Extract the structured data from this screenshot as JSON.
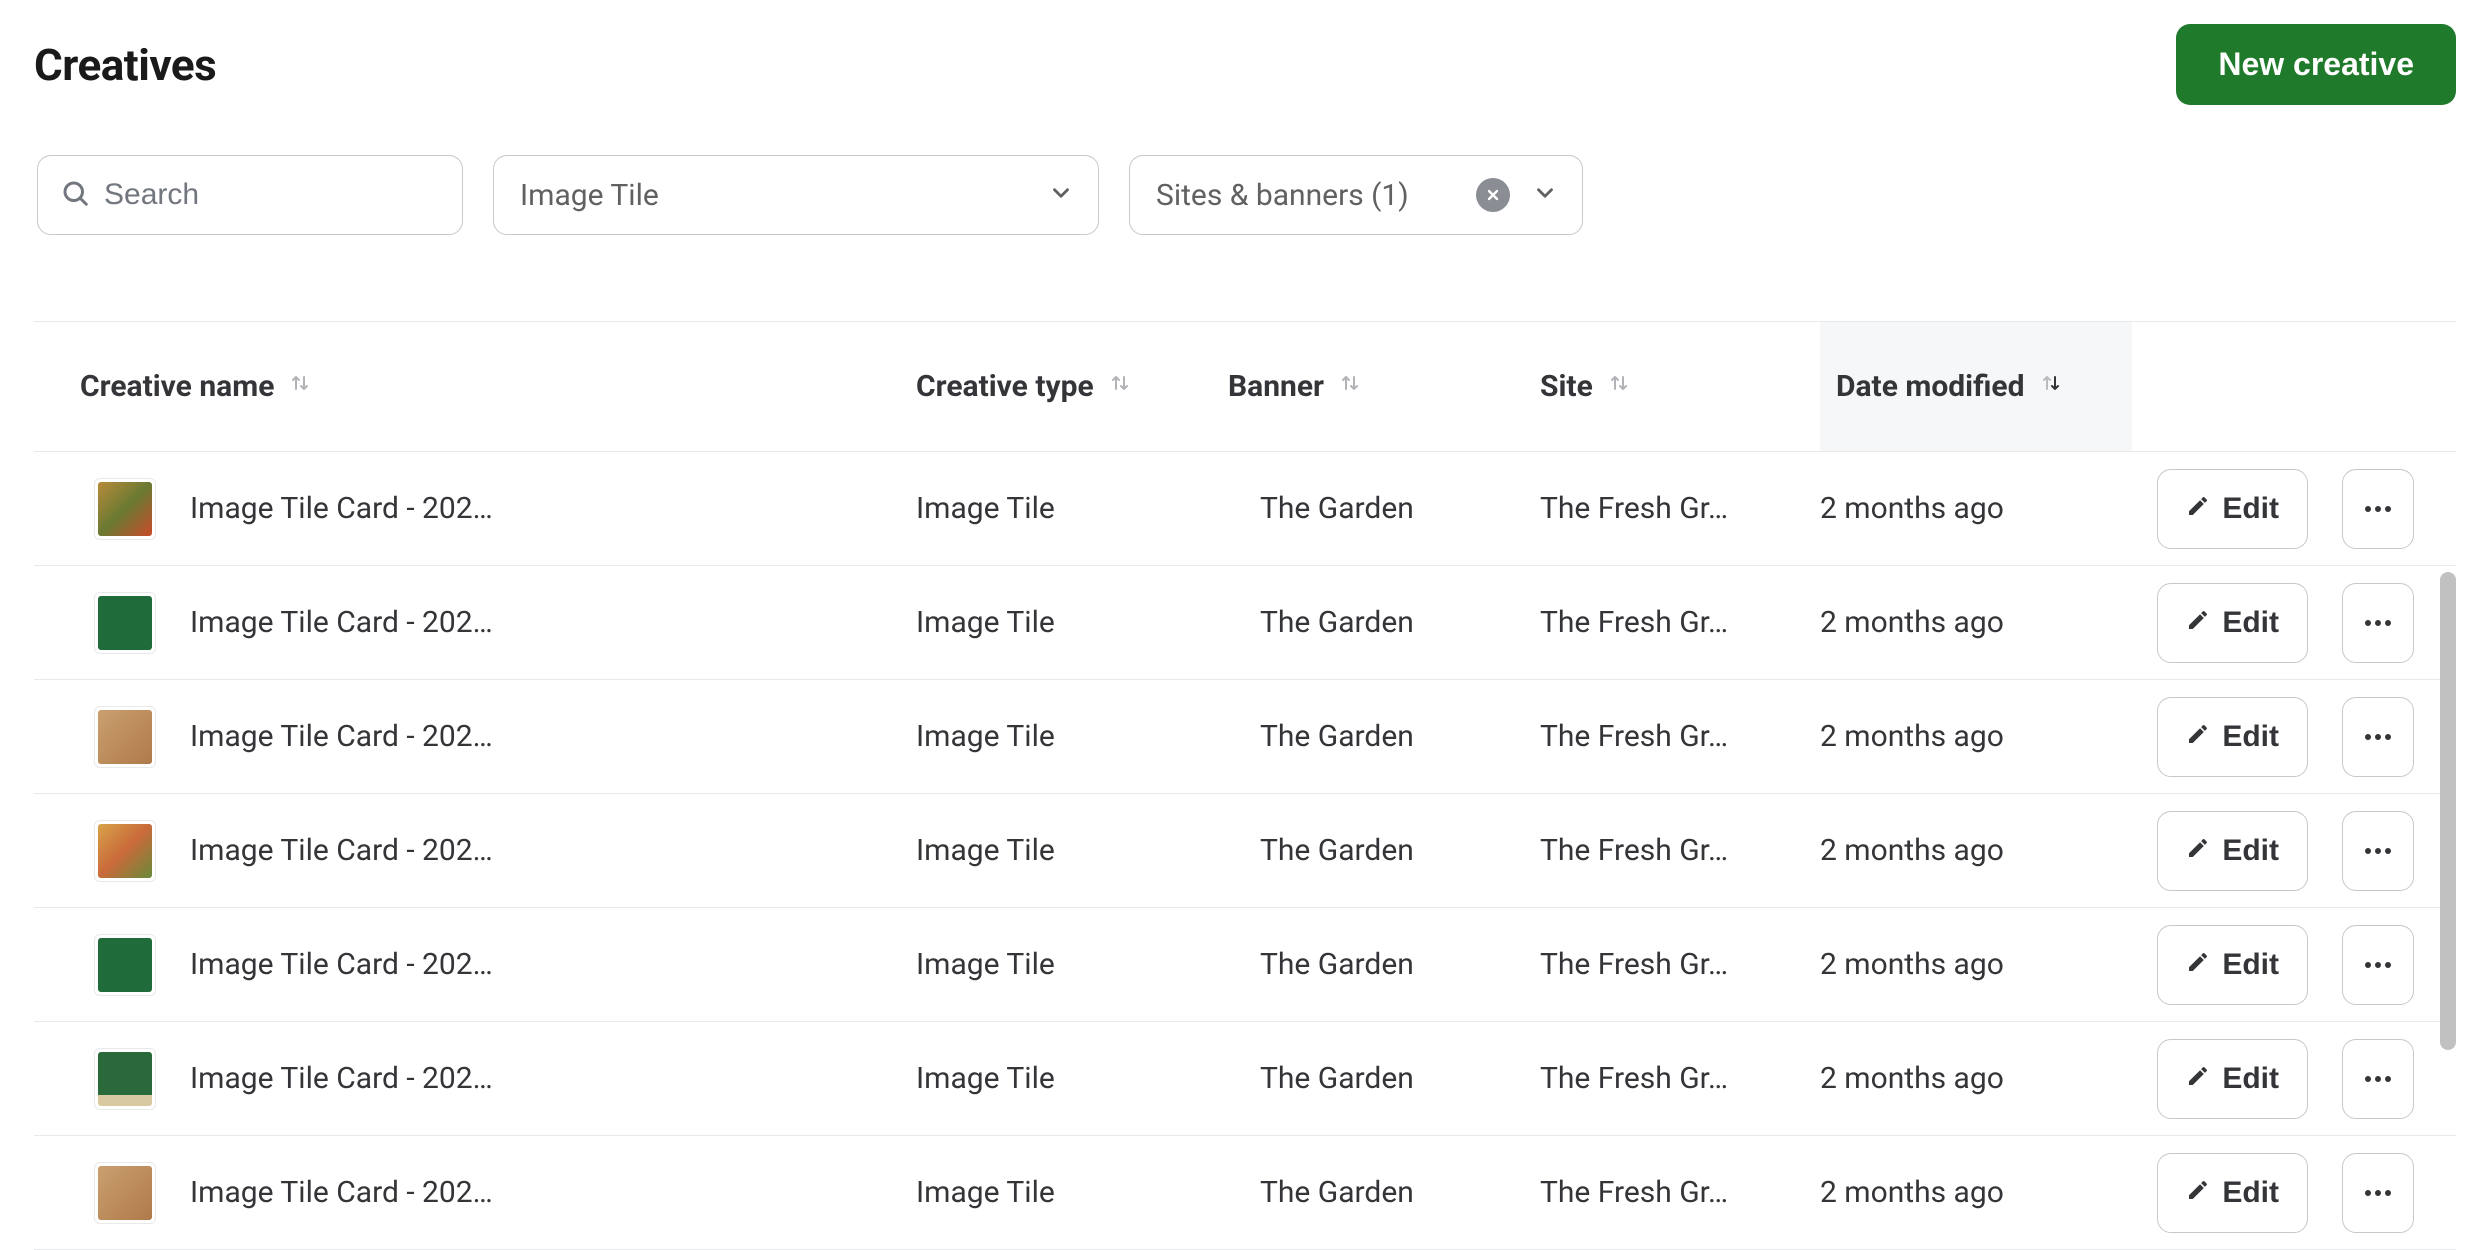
{
  "header": {
    "title": "Creatives",
    "new_button": "New creative"
  },
  "filters": {
    "search_placeholder": "Search",
    "type_dropdown": "Image Tile",
    "sites_dropdown": "Sites & banners (1)"
  },
  "table": {
    "headers": {
      "name": "Creative name",
      "type": "Creative type",
      "banner": "Banner",
      "site": "Site",
      "date": "Date modified"
    },
    "edit_label": "Edit",
    "rows": [
      {
        "name": "Image Tile Card - 202…",
        "type": "Image Tile",
        "banner": "The Garden",
        "site": "The Fresh Gr…",
        "date": "2 months ago",
        "thumb": "linear-gradient(135deg,#b88a3a,#6a7a32,#c94a2a)"
      },
      {
        "name": "Image Tile Card - 202…",
        "type": "Image Tile",
        "banner": "The Garden",
        "site": "The Fresh Gr…",
        "date": "2 months ago",
        "thumb": "#1f6b3a"
      },
      {
        "name": "Image Tile Card - 202…",
        "type": "Image Tile",
        "banner": "The Garden",
        "site": "The Fresh Gr…",
        "date": "2 months ago",
        "thumb": "linear-gradient(135deg,#caa070,#b07a4a)"
      },
      {
        "name": "Image Tile Card - 202…",
        "type": "Image Tile",
        "banner": "The Garden",
        "site": "The Fresh Gr…",
        "date": "2 months ago",
        "thumb": "linear-gradient(135deg,#d9a24a,#c96a3a,#6a8a3a)"
      },
      {
        "name": "Image Tile Card - 202…",
        "type": "Image Tile",
        "banner": "The Garden",
        "site": "The Fresh Gr…",
        "date": "2 months ago",
        "thumb": "#1f6b3a"
      },
      {
        "name": "Image Tile Card - 202…",
        "type": "Image Tile",
        "banner": "The Garden",
        "site": "The Fresh Gr…",
        "date": "2 months ago",
        "thumb": "linear-gradient(#2a6a3a 80%, #d9c9a0 80%)"
      },
      {
        "name": "Image Tile Card - 202…",
        "type": "Image Tile",
        "banner": "The Garden",
        "site": "The Fresh Gr…",
        "date": "2 months ago",
        "thumb": "linear-gradient(135deg,#caa070,#b07a4a)"
      }
    ]
  }
}
